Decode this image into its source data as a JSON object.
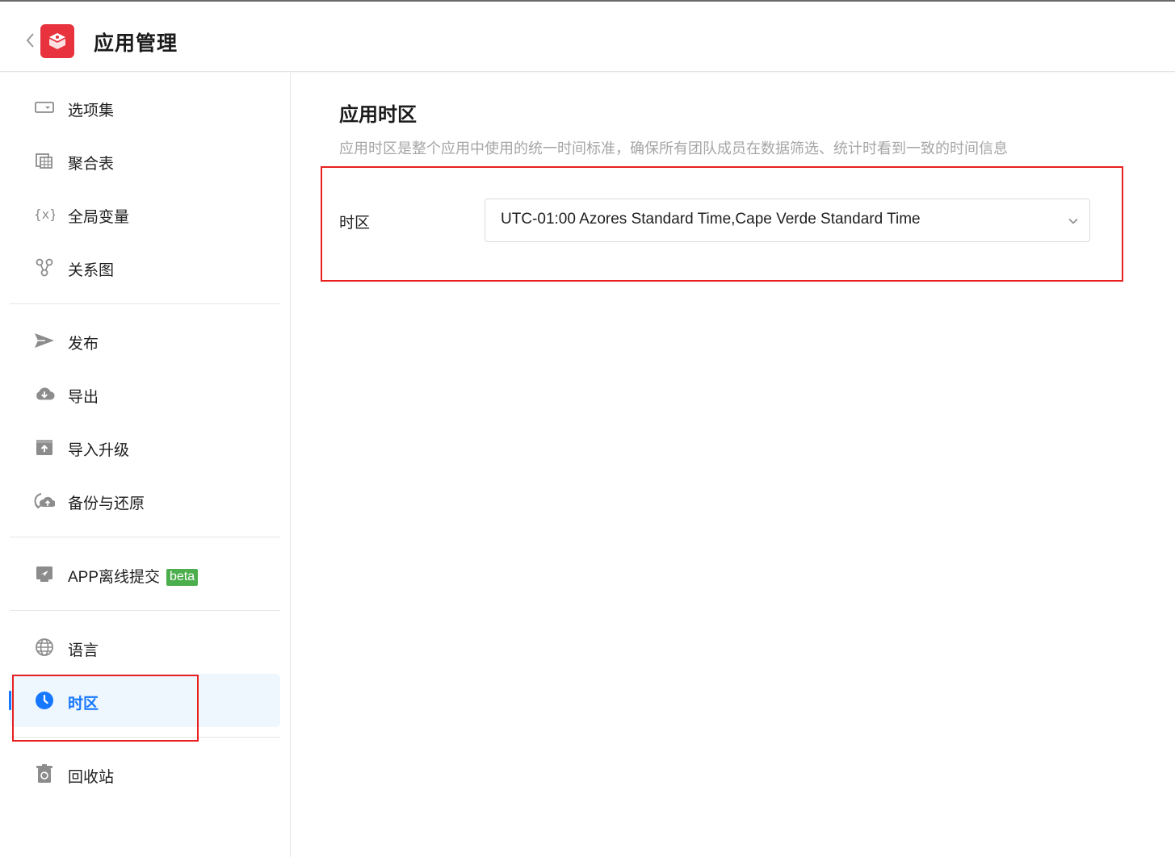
{
  "header": {
    "title": "应用管理",
    "logo_icon": "app-cube-icon",
    "back_icon": "chevron-left-icon"
  },
  "sidebar": {
    "groups": [
      [
        {
          "label": "选项集",
          "icon": "option-set-icon"
        },
        {
          "label": "聚合表",
          "icon": "aggregate-table-icon"
        },
        {
          "label": "全局变量",
          "icon": "variable-icon"
        },
        {
          "label": "关系图",
          "icon": "relation-graph-icon"
        }
      ],
      [
        {
          "label": "发布",
          "icon": "send-icon"
        },
        {
          "label": "导出",
          "icon": "cloud-download-icon"
        },
        {
          "label": "导入升级",
          "icon": "import-upgrade-icon"
        },
        {
          "label": "备份与还原",
          "icon": "backup-restore-icon"
        }
      ],
      [
        {
          "label": "APP离线提交",
          "icon": "offline-submit-icon",
          "badge": "beta"
        }
      ],
      [
        {
          "label": "语言",
          "icon": "globe-icon"
        },
        {
          "label": "时区",
          "icon": "clock-icon",
          "active": true
        }
      ],
      [
        {
          "label": "回收站",
          "icon": "recycle-bin-icon"
        }
      ]
    ]
  },
  "main": {
    "title": "应用时区",
    "description": "应用时区是整个应用中使用的统一时间标准，确保所有团队成员在数据筛选、统计时看到一致的时间信息",
    "timezone_label": "时区",
    "timezone_value": "UTC-01:00 Azores Standard Time,Cape Verde Standard Time"
  },
  "colors": {
    "accent": "#1677ff",
    "brand": "#e8323e",
    "highlight": "#e8201f",
    "beta": "#4cae4c"
  }
}
